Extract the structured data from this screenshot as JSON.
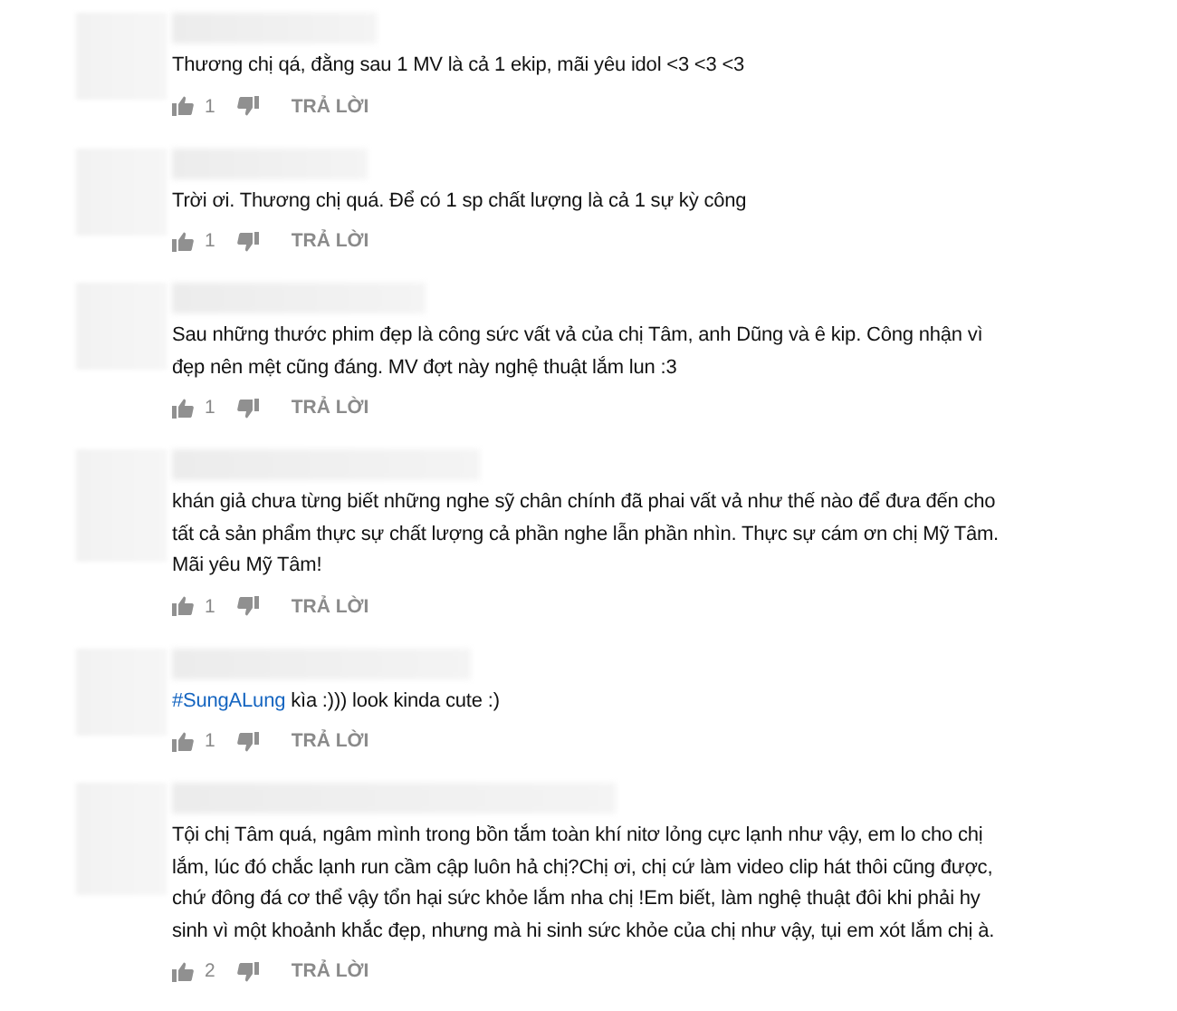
{
  "comments": [
    {
      "text": "Thương chị qá, đằng sau 1 MV là cả 1 ekip, mãi yêu idol <3 <3 <3",
      "likes": "1",
      "reply": "TRẢ LỜI"
    },
    {
      "text": "Trời ơi. Thương chị quá. Để có 1 sp chất lượng là cả 1 sự kỳ công",
      "likes": "1",
      "reply": "TRẢ LỜI"
    },
    {
      "text": "Sau những thước phim đẹp là công sức vất vả của chị Tâm, anh Dũng và ê kip. Công nhận vì đẹp nên mệt cũng đáng. MV đợt này nghệ thuật lắm lun :3",
      "likes": "1",
      "reply": "TRẢ LỜI"
    },
    {
      "text": "khán giả chưa từng biết những nghe sỹ chân chính đã phai vất vả như thế nào để đưa đến cho tất cả sản phẩm thực sự chất lượng cả phần nghe lẫn phần nhìn. Thực sự cám ơn chị Mỹ Tâm. Mãi yêu Mỹ Tâm!",
      "likes": "1",
      "reply": "TRẢ LỜI"
    },
    {
      "hashtag": "#SungALung",
      "text": "kìa :))) look kinda cute :)",
      "likes": "1",
      "reply": "TRẢ LỜI"
    },
    {
      "text": "Tội chị Tâm quá, ngâm mình trong bồn tắm toàn khí nitơ lỏng cực lạnh như vậy, em lo cho chị lắm, lúc đó chắc lạnh run cầm cập luôn hả chị?Chị ơi, chị cứ làm video clip hát thôi cũng được, chứ đông đá cơ thể vậy tổn hại sức khỏe lắm nha chị !Em biết, làm nghệ thuật đôi khi phải hy sinh vì một khoảnh khắc đẹp, nhưng mà hi sinh sức khỏe của chị như vậy, tụi em xót lắm chị à.",
      "likes": "2",
      "reply": "TRẢ LỜI"
    }
  ]
}
